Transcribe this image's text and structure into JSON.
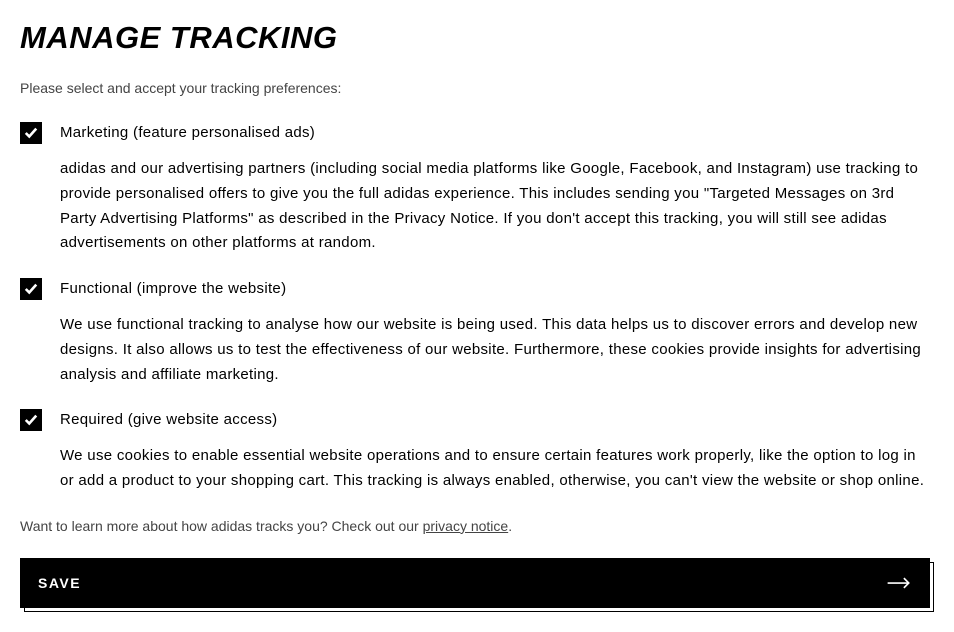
{
  "heading": "MANAGE TRACKING",
  "subtitle": "Please select and accept your tracking preferences:",
  "options": [
    {
      "title": "Marketing (feature personalised ads)",
      "desc": "adidas and our advertising partners (including social media platforms like Google, Facebook, and Instagram) use tracking to provide personalised offers to give you the full adidas experience. This includes sending you \"Targeted Messages on 3rd Party Advertising Platforms\" as described in the Privacy Notice. If you don't accept this tracking, you will still see adidas advertisements on other platforms at random."
    },
    {
      "title": "Functional (improve the website)",
      "desc": "We use functional tracking to analyse how our website is being used. This data helps us to discover errors and develop new designs. It also allows us to test the effectiveness of our website. Furthermore, these cookies provide insights for advertising analysis and affiliate marketing."
    },
    {
      "title": "Required (give website access)",
      "desc": "We use cookies to enable essential website operations and to ensure certain features work properly, like the option to log in or add a product to your shopping cart. This tracking is always enabled, otherwise, you can't view the website or shop online."
    }
  ],
  "footer_text": "Want to learn more about how adidas tracks you? Check out our ",
  "footer_link": "privacy notice",
  "footer_tail": ".",
  "save_label": "SAVE"
}
